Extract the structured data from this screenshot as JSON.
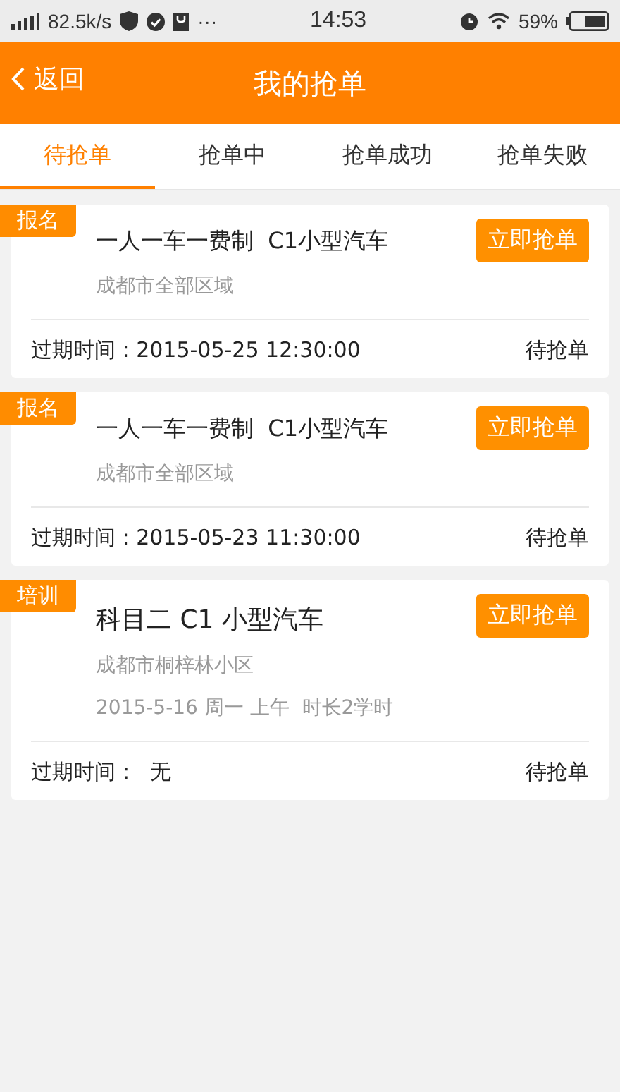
{
  "status_bar": {
    "speed": "82.5k/s",
    "more": "···",
    "time": "14:53",
    "battery": "59%"
  },
  "header": {
    "back": "返回",
    "title": "我的抢单"
  },
  "tabs": [
    {
      "label": "待抢单",
      "selected": true
    },
    {
      "label": "抢单中",
      "selected": false
    },
    {
      "label": "抢单成功",
      "selected": false
    },
    {
      "label": "抢单失败",
      "selected": false
    }
  ],
  "orders": [
    {
      "kind": "signup",
      "tag": "报名",
      "title": "一人一车一费制  C1小型汽车",
      "location": "成都市全部区域",
      "button": "立即抢单",
      "expiry": "过期时间 : 2015-05-25 12:30:00",
      "status": "待抢单"
    },
    {
      "kind": "signup",
      "tag": "报名",
      "title": "一人一车一费制  C1小型汽车",
      "location": "成都市全部区域",
      "button": "立即抢单",
      "expiry": "过期时间 : 2015-05-23 11:30:00",
      "status": "待抢单"
    },
    {
      "kind": "training",
      "tag": "培训",
      "title": "科目二 C1 小型汽车",
      "location": "成都市桐梓林小区",
      "schedule": "2015-5-16 周一 上午  时长2学时",
      "button": "立即抢单",
      "expiry": "过期时间：  无",
      "status": "待抢单"
    }
  ]
}
